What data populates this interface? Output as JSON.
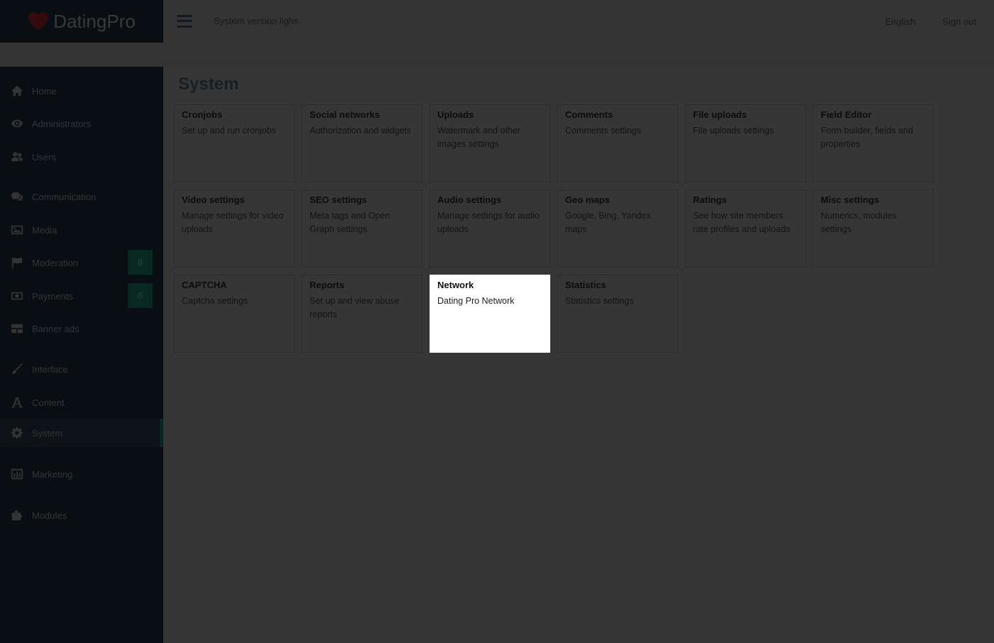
{
  "brand": {
    "name": "DatingPro",
    "icon": "heart-icon",
    "heart_color": "#e3343f"
  },
  "topbar": {
    "title": "System version lighs",
    "language": "English",
    "signout": "Sign out"
  },
  "sidebar": {
    "items": [
      {
        "label": "Home",
        "icon": "home-icon"
      },
      {
        "label": "Administrators",
        "icon": "eye-icon"
      },
      {
        "label": "Users",
        "icon": "users-icon"
      },
      {
        "label": "Communication",
        "icon": "comments-icon"
      },
      {
        "label": "Media",
        "icon": "image-icon"
      },
      {
        "label": "Moderation",
        "icon": "flag-icon",
        "badge": "8"
      },
      {
        "label": "Payments",
        "icon": "money-icon",
        "badge": "6"
      },
      {
        "label": "Banner ads",
        "icon": "grid-icon"
      },
      {
        "label": "Interface",
        "icon": "brush-icon"
      },
      {
        "label": "Content",
        "icon": "font-icon"
      },
      {
        "label": "System",
        "icon": "gear-icon",
        "active": true
      },
      {
        "label": "Marketing",
        "icon": "chart-icon"
      },
      {
        "label": "Modules",
        "icon": "puzzle-icon"
      }
    ]
  },
  "main": {
    "title": "System",
    "cards": [
      {
        "title": "Cronjobs",
        "desc": "Set up and run cronjobs"
      },
      {
        "title": "Social networks",
        "desc": "Authorization and widgets"
      },
      {
        "title": "Uploads",
        "desc": "Watermark and other images settings"
      },
      {
        "title": "Comments",
        "desc": "Comments settings"
      },
      {
        "title": "File uploads",
        "desc": "File uploads settings"
      },
      {
        "title": "Field Editor",
        "desc": "Form builder, fields and properties"
      },
      {
        "title": "Video settings",
        "desc": "Manage settings for video uploads"
      },
      {
        "title": "SEO settings",
        "desc": "Meta tags and Open Graph settings"
      },
      {
        "title": "Audio settings",
        "desc": "Manage settings for audio uploads"
      },
      {
        "title": "Geo maps",
        "desc": "Google, Bing, Yandex maps"
      },
      {
        "title": "Ratings",
        "desc": "See how site members rate profiles and uploads"
      },
      {
        "title": "Misc settings",
        "desc": "Numerics, modules settings"
      },
      {
        "title": "CAPTCHA",
        "desc": "Captcha settings"
      },
      {
        "title": "Reports",
        "desc": "Set up and view abuse reports"
      },
      {
        "title": "Network",
        "desc": "Dating Pro Network",
        "selected": true
      },
      {
        "title": "Statistics",
        "desc": "Statistics settings"
      }
    ]
  },
  "colors": {
    "accent": "#1abb9c",
    "badge": "#26b99a",
    "sidebar": "#2a3f54"
  }
}
